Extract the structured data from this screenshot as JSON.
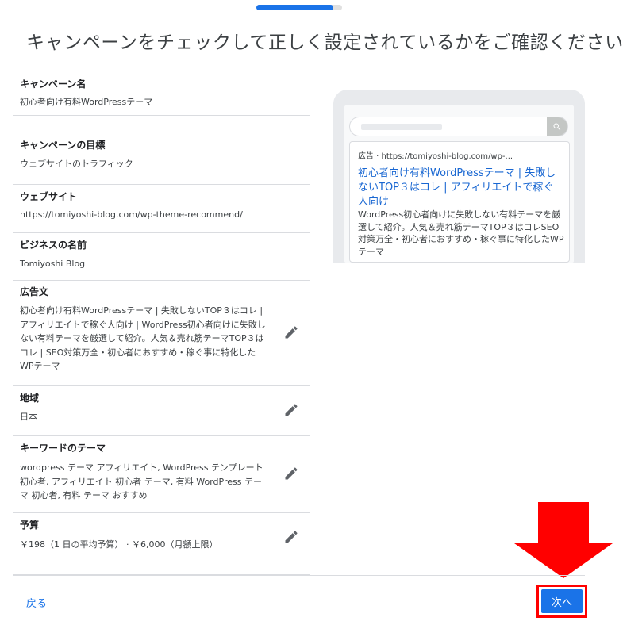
{
  "progress": {
    "fraction": 0.9
  },
  "title": "キャンペーンをチェックして正しく設定されているかをご確認ください",
  "sections": [
    {
      "title": "キャンペーン名",
      "value": "初心者向け有料WordPressテーマ",
      "editable": false
    },
    {
      "title": "キャンペーンの目標",
      "value": "ウェブサイトのトラフィック",
      "editable": false
    },
    {
      "title": "ウェブサイト",
      "value": "https://tomiyoshi-blog.com/wp-theme-recommend/",
      "editable": false
    },
    {
      "title": "ビジネスの名前",
      "value": "Tomiyoshi Blog",
      "editable": false
    },
    {
      "title": "広告文",
      "value": "初心者向け有料WordPressテーマ | 失敗しないTOP３はコレ | アフィリエイトで稼ぐ人向け | WordPress初心者向けに失敗しない有料テーマを厳選して紹介。人気＆売れ筋テーマTOP３はコレ | SEO対策万全・初心者におすすめ・稼ぐ事に特化したWPテーマ",
      "editable": true
    },
    {
      "title": "地域",
      "value": "日本",
      "editable": true
    },
    {
      "title": "キーワードのテーマ",
      "value": "wordpress テーマ アフィリエイト, WordPress テンプレート 初心者, アフィリエイト 初心者 テーマ, 有料 WordPress テーマ 初心者, 有料 テーマ おすすめ",
      "editable": true
    },
    {
      "title": "予算",
      "value": "￥198（1 日の平均予算） · ￥6,000（月額上限）",
      "editable": true
    }
  ],
  "preview": {
    "ad_label": "広告 · https://tomiyoshi-blog.com/wp-...",
    "headline": "初心者向け有料WordPressテーマ | 失敗しないTOP３はコレ | アフィリエイトで稼ぐ人向け",
    "description": "WordPress初心者向けに失敗しない有料テーマを厳選して紹介。人気＆売れ筋テーマTOP３はコレSEO対策万全・初心者におすすめ・稼ぐ事に特化したWPテーマ"
  },
  "footer": {
    "back_label": "戻る",
    "next_label": "次へ"
  },
  "colors": {
    "accent": "#1a73e8",
    "highlight": "#ff0000"
  },
  "icons": {
    "edit": "pencil-icon",
    "search": "search-icon",
    "arrow": "arrow-down-icon"
  }
}
